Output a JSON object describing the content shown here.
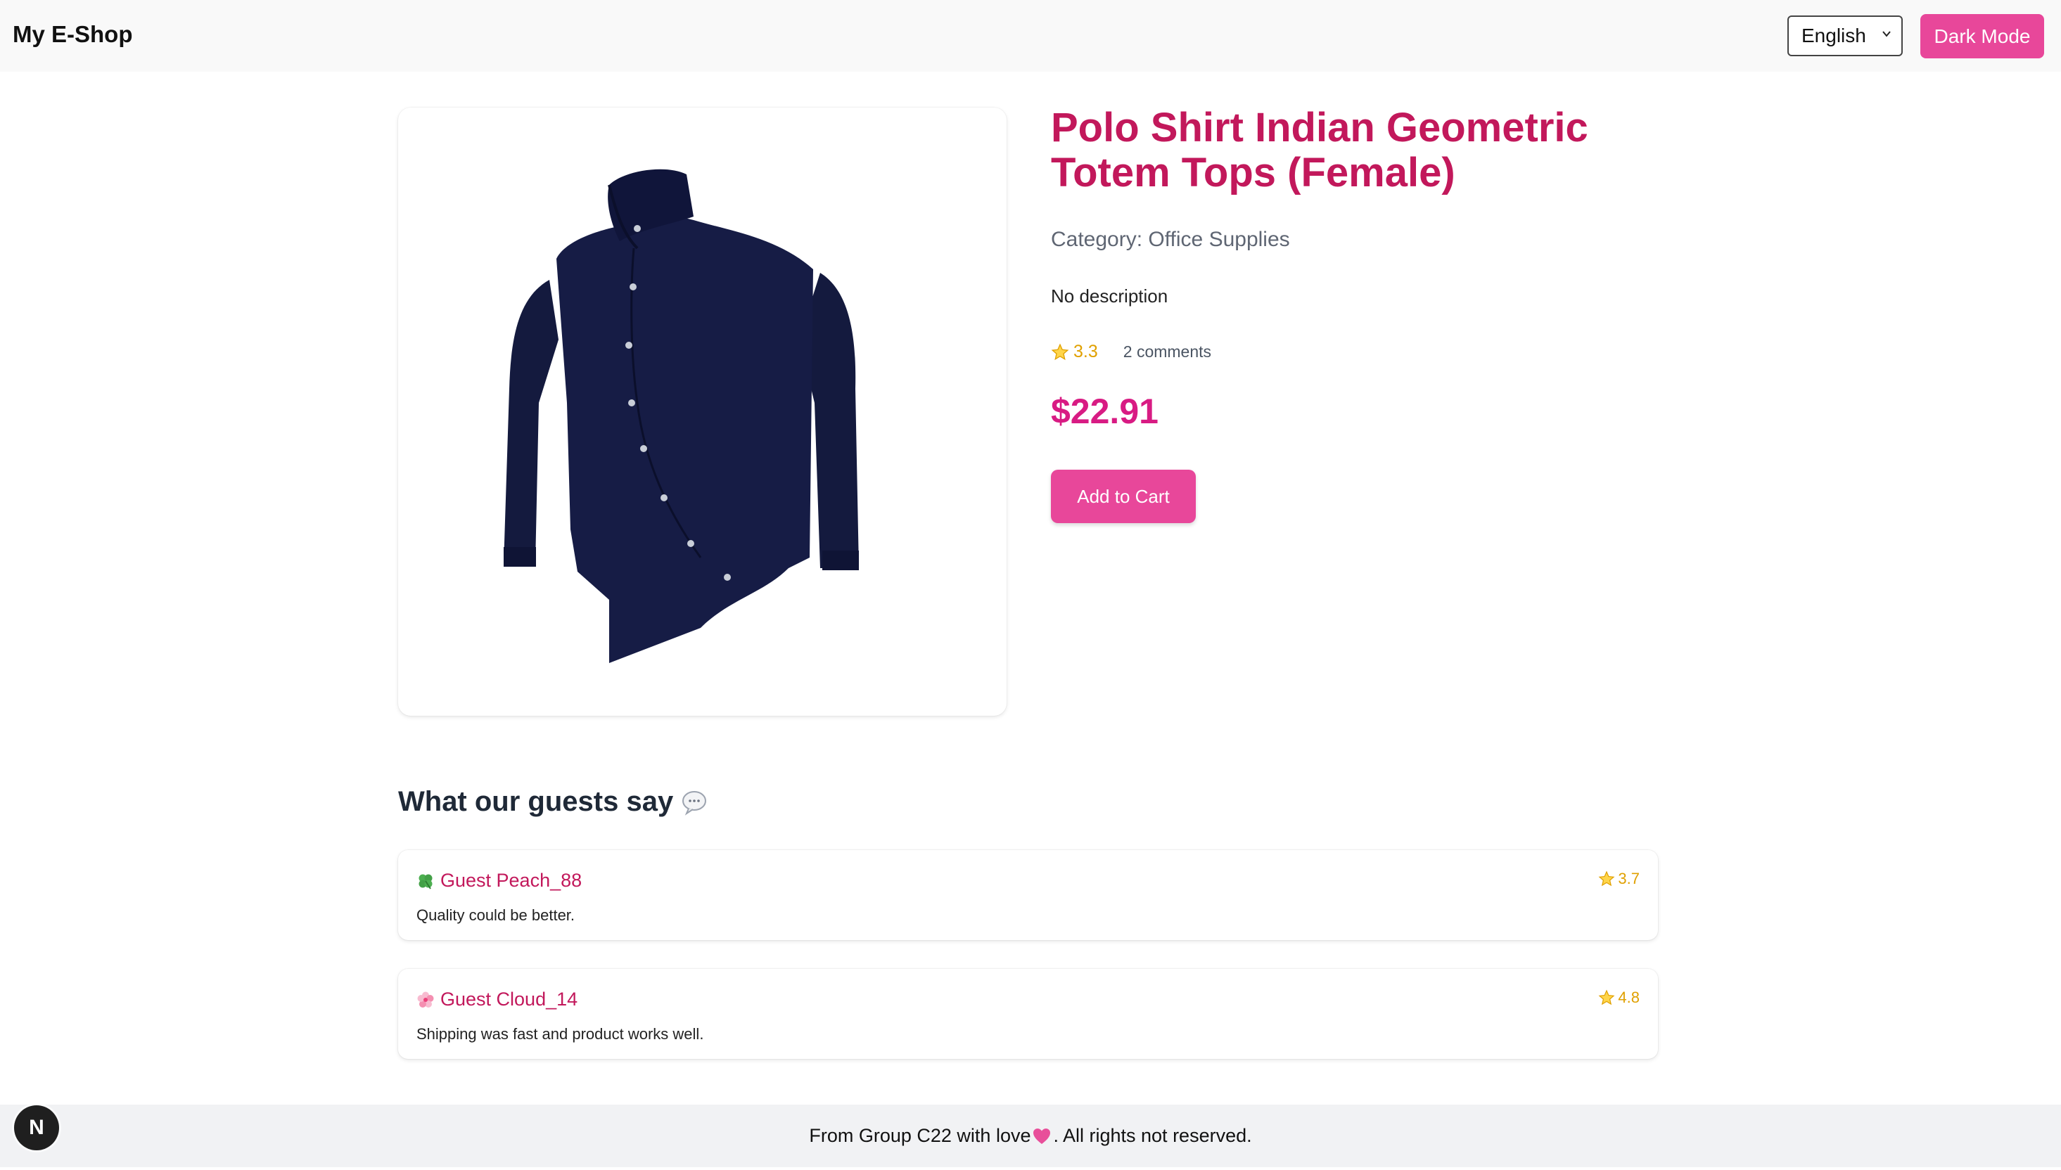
{
  "header": {
    "brand": "My E-Shop",
    "language": "English",
    "dark_mode_label": "Dark Mode"
  },
  "product": {
    "title": "Polo Shirt Indian Geometric Totem Tops (Female)",
    "category_label": "Category:",
    "category": "Office Supplies",
    "description": "No description",
    "rating": "3.3",
    "comments": "2 comments",
    "price": "$22.91",
    "add_to_cart": "Add to Cart",
    "image_icon": "navy-shirt-image"
  },
  "reviews": {
    "heading": "What our guests say",
    "items": [
      {
        "emoji": "clover",
        "name": "Guest Peach_88",
        "text": "Quality could be better.",
        "rating": "3.7"
      },
      {
        "emoji": "blossom",
        "name": "Guest Cloud_14",
        "text": "Shipping was fast and product works well.",
        "rating": "4.8"
      }
    ]
  },
  "footer": {
    "before": "From Group C22 with love ",
    "after": ". All rights not reserved."
  },
  "badge": {
    "letter": "N"
  },
  "colors": {
    "accent": "#e8479a",
    "title": "#c2185b",
    "price": "#d81b83",
    "star": "#e0a000"
  }
}
